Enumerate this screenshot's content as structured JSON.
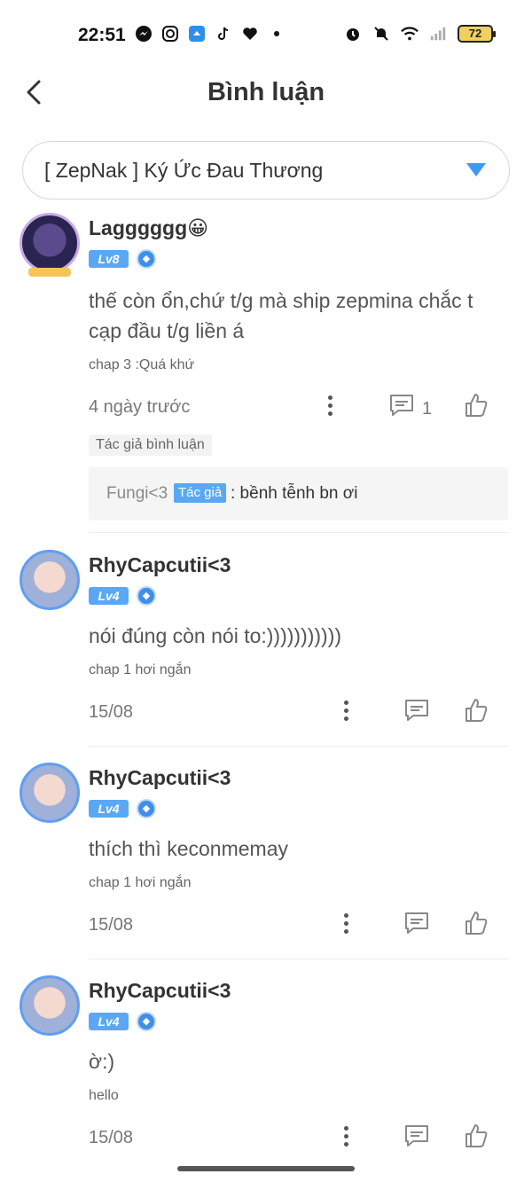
{
  "status_bar": {
    "time": "22:51",
    "battery": "72",
    "left_icons": [
      "messenger-icon",
      "instagram-icon",
      "cloud-icon",
      "tiktok-icon",
      "heart-icon",
      "dot-icon"
    ],
    "right_icons": [
      "alarm-icon",
      "bell-off-icon",
      "wifi-icon",
      "signal-icon"
    ]
  },
  "header": {
    "title": "Bình luận"
  },
  "story_select": {
    "value": "[ ZepNak ] Ký Ức Đau Thương",
    "accent": "#3d9af0"
  },
  "comments": [
    {
      "username": "Lagggggg😀",
      "level": "Lv8",
      "text": "thế còn ổn,chứ t/g mà ship zepmina chắc t cạp đầu t/g liền á",
      "chapter": "chap 3 :Quá khứ",
      "date": "4 ngày trước",
      "reply_count": "1",
      "author_tag": "Tác giả bình luận",
      "reply": {
        "name": "Fungi<3",
        "badge": "Tác giả",
        "text": ": bềnh tễnh bn ơi"
      }
    },
    {
      "username": "RhyCapcutii<3",
      "level": "Lv4",
      "text": "nói đúng còn nói to:)))))))))))",
      "chapter": "chap 1 hơi ngắn",
      "date": "15/08"
    },
    {
      "username": "RhyCapcutii<3",
      "level": "Lv4",
      "text": "thích thì keconmemay",
      "chapter": "chap 1 hơi ngắn",
      "date": "15/08"
    },
    {
      "username": "RhyCapcutii<3",
      "level": "Lv4",
      "text": "ờ:)",
      "chapter": "hello",
      "date": "15/08"
    }
  ]
}
